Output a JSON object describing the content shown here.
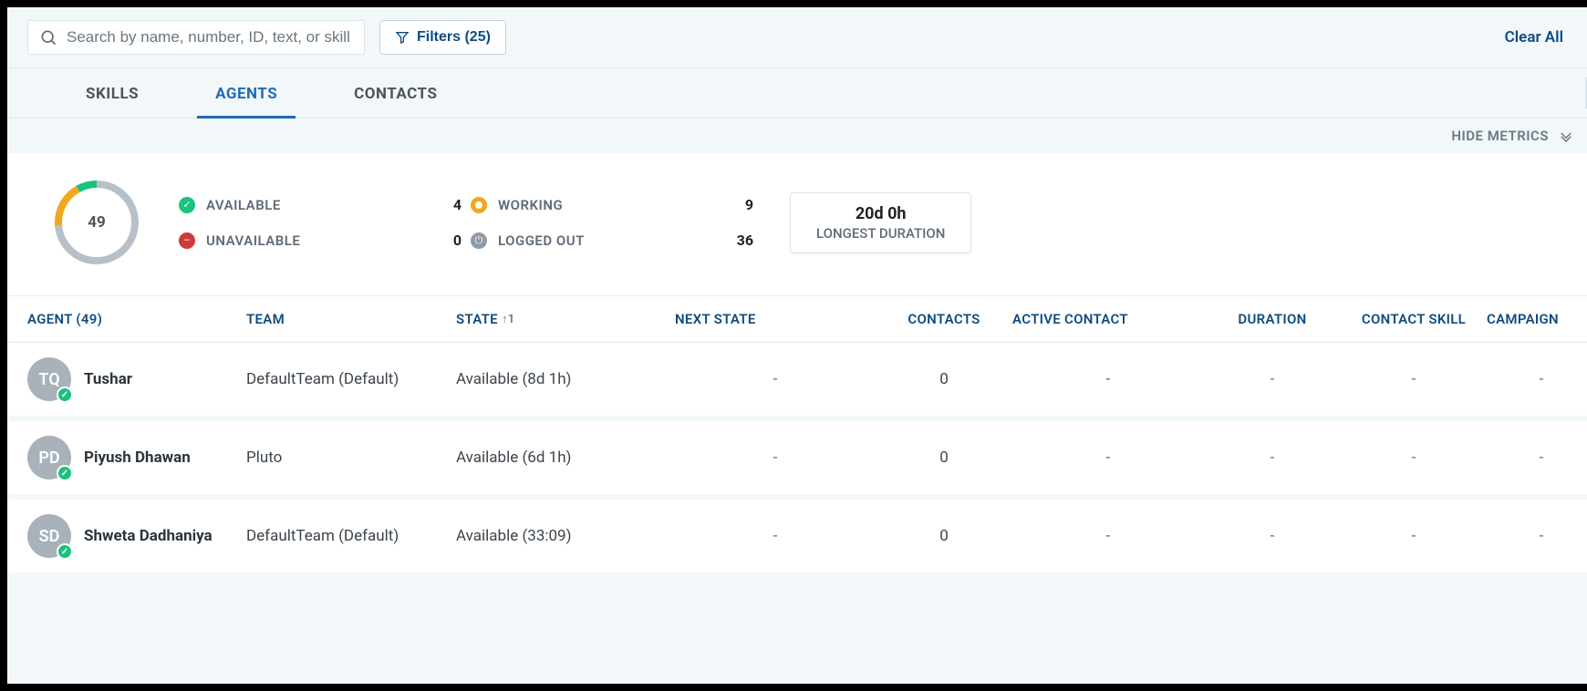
{
  "search": {
    "placeholder": "Search by name, number, ID, text, or skill"
  },
  "filters": {
    "label": "Filters (25)"
  },
  "clear_all": "Clear All",
  "tabs": {
    "skills": "SKILLS",
    "agents": "AGENTS",
    "contacts": "CONTACTS"
  },
  "hide_metrics": "HIDE METRICS",
  "metrics": {
    "total": "49",
    "available": {
      "label": "AVAILABLE",
      "value": "4"
    },
    "unavailable": {
      "label": "UNAVAILABLE",
      "value": "0"
    },
    "working": {
      "label": "WORKING",
      "value": "9"
    },
    "logged_out": {
      "label": "LOGGED OUT",
      "value": "36"
    },
    "longest": {
      "value": "20d 0h",
      "label": "LONGEST DURATION"
    }
  },
  "columns": {
    "agent": "AGENT (49)",
    "team": "TEAM",
    "state": "STATE",
    "state_sort": "↑1",
    "next_state": "NEXT STATE",
    "contacts": "CONTACTS",
    "active_contact": "ACTIVE CONTACT",
    "duration": "DURATION",
    "contact_skill": "CONTACT SKILL",
    "campaign": "CAMPAIGN"
  },
  "rows": [
    {
      "initials": "TQ",
      "name": "Tushar",
      "team": "DefaultTeam (Default)",
      "state": "Available (8d 1h)",
      "next_state": "-",
      "contacts": "0",
      "active_contact": "-",
      "duration": "-",
      "contact_skill": "-",
      "campaign": "-"
    },
    {
      "initials": "PD",
      "name": "Piyush Dhawan",
      "team": "Pluto",
      "state": "Available (6d 1h)",
      "next_state": "-",
      "contacts": "0",
      "active_contact": "-",
      "duration": "-",
      "contact_skill": "-",
      "campaign": "-"
    },
    {
      "initials": "SD",
      "name": "Shweta Dadhaniya",
      "team": "DefaultTeam (Default)",
      "state": "Available (33:09)",
      "next_state": "-",
      "contacts": "0",
      "active_contact": "-",
      "duration": "-",
      "contact_skill": "-",
      "campaign": "-"
    }
  ],
  "chart_data": {
    "type": "pie",
    "title": "",
    "total": 49,
    "series": [
      {
        "name": "Available",
        "value": 4,
        "color": "#19c37d"
      },
      {
        "name": "Unavailable",
        "value": 0,
        "color": "#d13a3a"
      },
      {
        "name": "Working",
        "value": 9,
        "color": "#f0a81e"
      },
      {
        "name": "Logged Out",
        "value": 36,
        "color": "#b7c0c8"
      }
    ]
  }
}
